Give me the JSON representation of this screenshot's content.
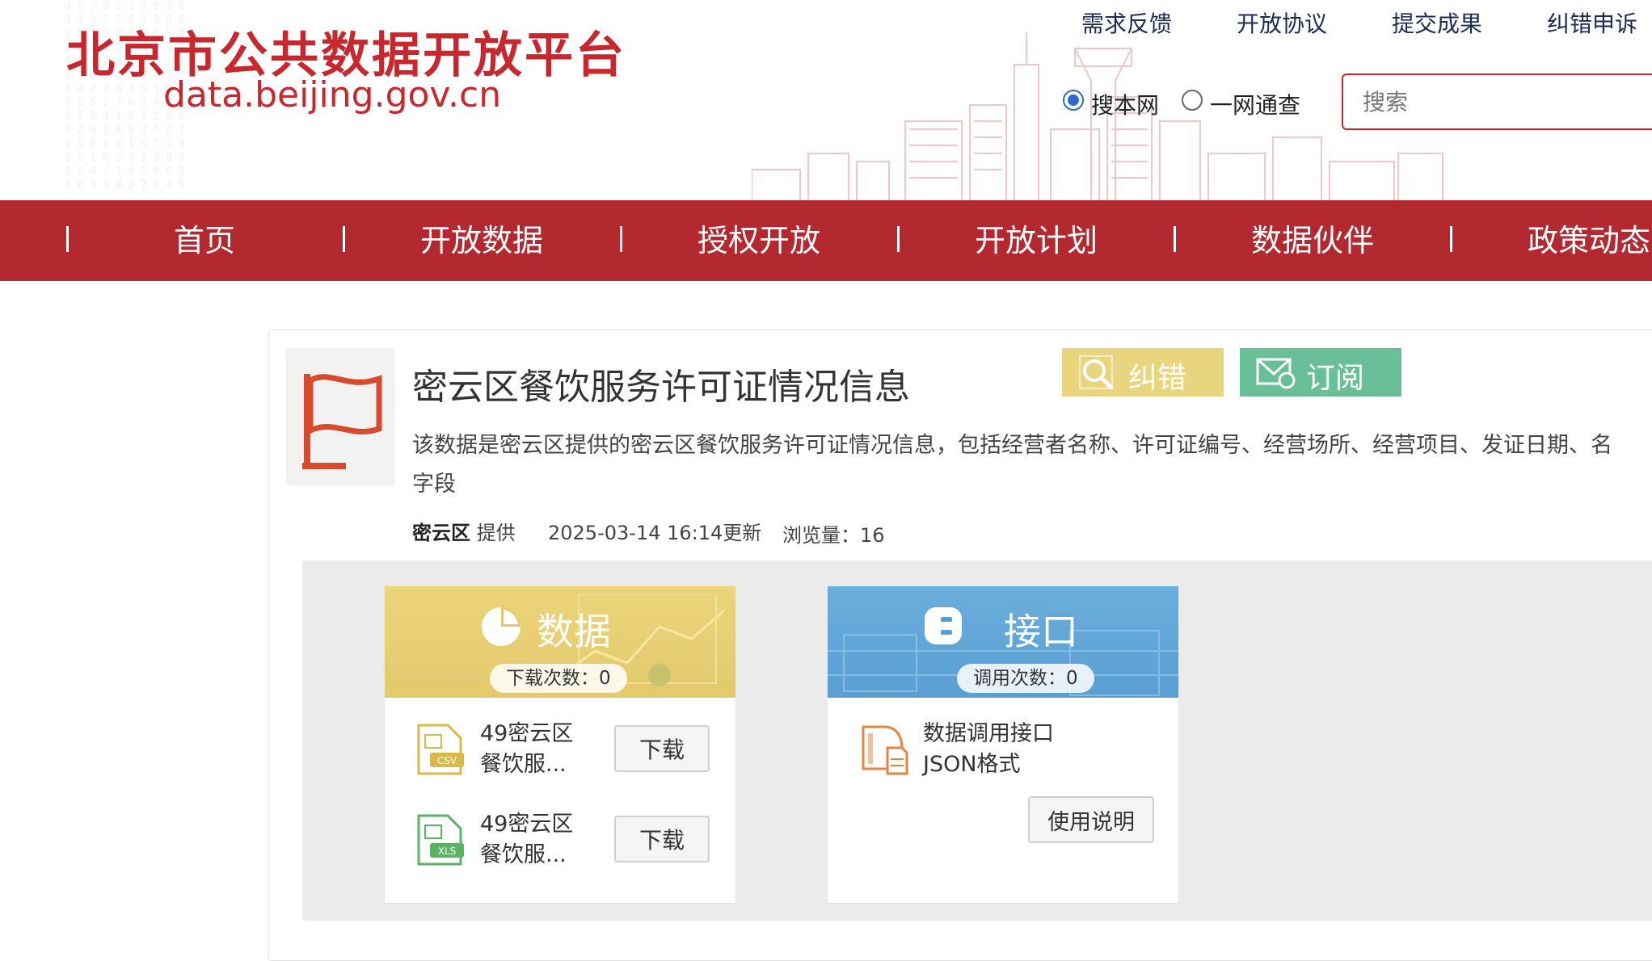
{
  "header": {
    "logo_cn": "北京市公共数据开放平台",
    "logo_en": "data.beijing.gov.cn",
    "top_links": [
      "需求反馈",
      "开放协议",
      "提交成果",
      "纠错申诉"
    ],
    "search_scope": {
      "options": [
        "搜本网",
        "一网通查"
      ],
      "selected": "搜本网"
    },
    "search_placeholder": "搜索"
  },
  "nav": {
    "items": [
      "首页",
      "开放数据",
      "授权开放",
      "开放计划",
      "数据伙伴",
      "政策动态"
    ]
  },
  "dataset": {
    "title": "密云区餐饮服务许可证情况信息",
    "correct_label": "纠错",
    "subscribe_label": "订阅",
    "description_line1": "该数据是密云区提供的密云区餐饮服务许可证情况信息，包括经营者名称、许可证编号、经营场所、经营项目、发证日期、名",
    "description_line2": "字段",
    "provider": "密云区",
    "provider_suffix": "提供",
    "updated": "2025-03-14 16:14更新",
    "views_label": "浏览量：",
    "views": "16"
  },
  "data_card": {
    "title": "数据",
    "download_count_text": "下载次数：0",
    "files": [
      {
        "type": "CSV",
        "name": "49密云区餐饮服...",
        "button": "下载"
      },
      {
        "type": "XLS",
        "name": "49密云区餐饮服...",
        "button": "下载"
      }
    ]
  },
  "api_card": {
    "title": "接口",
    "call_count_text": "调用次数：0",
    "api_name": "数据调用接口JSON格式",
    "button": "使用说明"
  },
  "colors": {
    "brand_red": "#b3292f",
    "logo_red": "#c8282d",
    "correct_yellow": "#e8d57e",
    "subscribe_green": "#68bf98"
  }
}
